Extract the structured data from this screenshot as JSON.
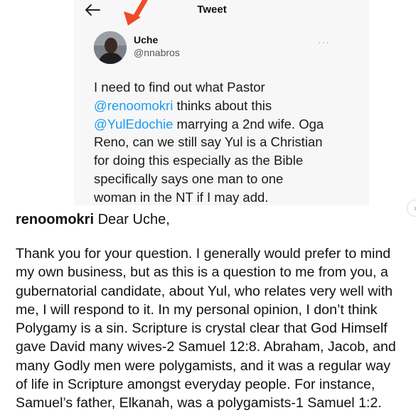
{
  "header": {
    "title": "Tweet"
  },
  "tweet": {
    "author_name": "Uche",
    "author_handle": "@nnabros",
    "lines": [
      [
        {
          "t": "I need to find out what Pastor",
          "m": false
        }
      ],
      [
        {
          "t": "@renoomokri",
          "m": true
        },
        {
          "t": " thinks about this",
          "m": false
        }
      ],
      [
        {
          "t": "@YulEdochie",
          "m": true
        },
        {
          "t": " marrying a 2nd wife. Oga",
          "m": false
        }
      ],
      [
        {
          "t": "Reno, can we still say Yul is a Christian",
          "m": false
        }
      ],
      [
        {
          "t": "for doing this especially as the Bible",
          "m": false
        }
      ],
      [
        {
          "t": "specifically says one man to one",
          "m": false
        }
      ],
      [
        {
          "t": "woman in the NT if I may add.",
          "m": false
        }
      ]
    ]
  },
  "caption": {
    "username": "renoomokri",
    "greeting": "Dear Uche,",
    "lines": [
      "Thank you for your question. I generally would prefer to mind",
      "my own business, but as this is a question to me from you, a",
      "gubernatorial candidate, about Yul, who relates very well with",
      "me, I will respond to it. In my personal opinion, I don’t think",
      "Polygamy is a sin. Scripture is crystal clear that God Himself",
      "gave David many wives-2 Samuel 12:8. Abraham, Jacob, and",
      "many Godly men were polygamists, and it was a regular way",
      "of life in Scripture amongst everyday people. For instance,",
      "Samuel’s father, Elkanah, was a polygamists-1 Samuel 1:2."
    ]
  },
  "colors": {
    "mention": "#1d9bf0",
    "arrow": "#ef4a2a"
  },
  "icons": {
    "back": "arrow-left-icon",
    "more": "more-horizontal-icon",
    "pointer": "red-arrow-annotation"
  }
}
